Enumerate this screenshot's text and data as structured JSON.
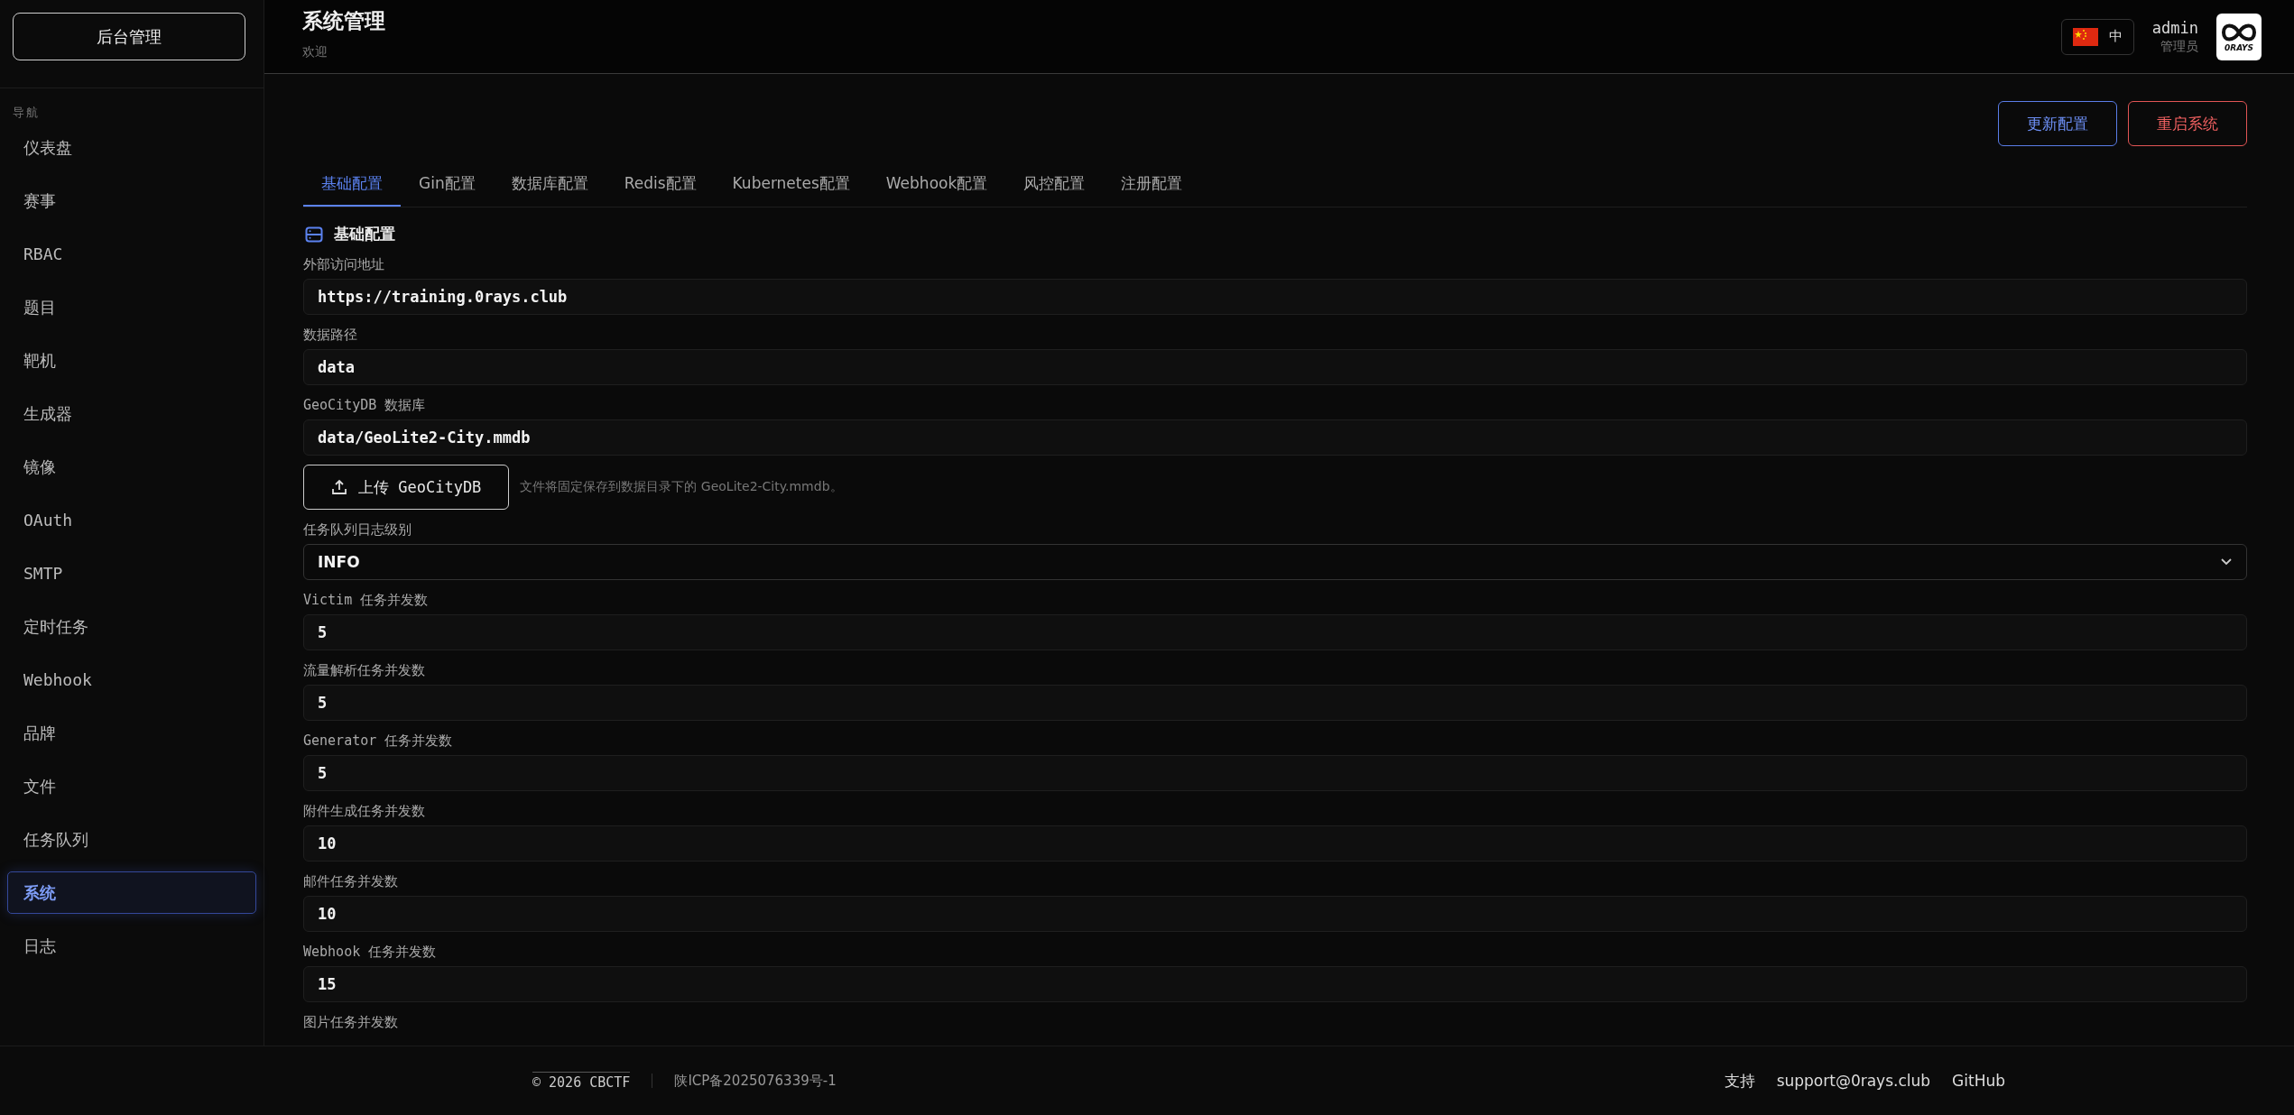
{
  "sidebar": {
    "brand": "后台管理",
    "section": "导航",
    "items": [
      {
        "label": "仪表盘",
        "selected": false
      },
      {
        "label": "赛事",
        "selected": false
      },
      {
        "label": "RBAC",
        "selected": false
      },
      {
        "label": "题目",
        "selected": false
      },
      {
        "label": "靶机",
        "selected": false
      },
      {
        "label": "生成器",
        "selected": false
      },
      {
        "label": "镜像",
        "selected": false
      },
      {
        "label": "OAuth",
        "selected": false
      },
      {
        "label": "SMTP",
        "selected": false
      },
      {
        "label": "定时任务",
        "selected": false
      },
      {
        "label": "Webhook",
        "selected": false
      },
      {
        "label": "品牌",
        "selected": false
      },
      {
        "label": "文件",
        "selected": false
      },
      {
        "label": "任务队列",
        "selected": false
      },
      {
        "label": "系统",
        "selected": true
      },
      {
        "label": "日志",
        "selected": false
      }
    ]
  },
  "header": {
    "title": "系统管理",
    "subtitle": "欢迎",
    "language": "中",
    "user": {
      "name": "admin",
      "role": "管理员"
    },
    "logo_text": "0RAYS"
  },
  "actions": [
    {
      "label": "更新配置",
      "kind": "primary"
    },
    {
      "label": "重启系统",
      "kind": "danger"
    }
  ],
  "tabs": [
    {
      "label": "基础配置",
      "selected": true
    },
    {
      "label": "Gin配置",
      "selected": false
    },
    {
      "label": "数据库配置",
      "selected": false
    },
    {
      "label": "Redis配置",
      "selected": false
    },
    {
      "label": "Kubernetes配置",
      "selected": false
    },
    {
      "label": "Webhook配置",
      "selected": false
    },
    {
      "label": "风控配置",
      "selected": false
    },
    {
      "label": "注册配置",
      "selected": false
    }
  ],
  "section": {
    "title": "基础配置"
  },
  "fields": [
    {
      "kind": "text",
      "label": "外部访问地址",
      "value": "https://training.0rays.club"
    },
    {
      "kind": "text",
      "label": "数据路径",
      "value": "data"
    },
    {
      "kind": "text",
      "label": "GeoCityDB 数据库",
      "value": "data/GeoLite2-City.mmdb"
    },
    {
      "kind": "upload",
      "button": "上传 GeoCityDB",
      "hint": "文件将固定保存到数据目录下的 GeoLite2-City.mmdb。"
    },
    {
      "kind": "select",
      "label": "任务队列日志级别",
      "value": "INFO"
    },
    {
      "kind": "text",
      "label": "Victim 任务并发数",
      "value": "5"
    },
    {
      "kind": "text",
      "label": "流量解析任务并发数",
      "value": "5"
    },
    {
      "kind": "text",
      "label": "Generator 任务并发数",
      "value": "5"
    },
    {
      "kind": "text",
      "label": "附件生成任务并发数",
      "value": "10"
    },
    {
      "kind": "text",
      "label": "邮件任务并发数",
      "value": "10"
    },
    {
      "kind": "text",
      "label": "Webhook 任务并发数",
      "value": "15"
    },
    {
      "kind": "text",
      "label": "图片任务并发数"
    }
  ],
  "footer": {
    "copyright": "© 2026 CBCTF",
    "icp": "陕ICP备2025076339号-1",
    "support_label": "支持",
    "email": "support@0rays.club",
    "github": "GitHub"
  }
}
